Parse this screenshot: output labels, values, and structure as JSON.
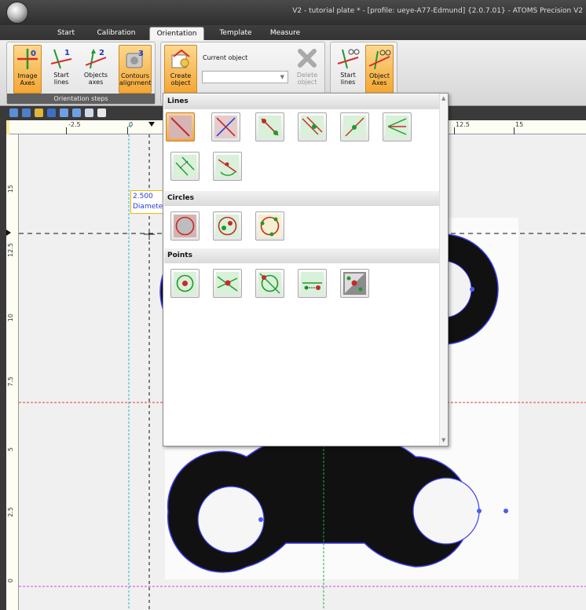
{
  "window": {
    "title": "V2 - tutorial plate * - [profile: ueye-A77-Edmund] {2.0.7.01} - ATOMS Precision V2"
  },
  "ribbon_tabs": [
    {
      "label": "Start"
    },
    {
      "label": "Calibration"
    },
    {
      "label": "Orientation",
      "active": true
    },
    {
      "label": "Template"
    },
    {
      "label": "Measure"
    }
  ],
  "orientation_steps": {
    "group_label": "Orientation steps",
    "buttons": [
      {
        "label": "Image Axes",
        "step": "0",
        "icon": "image-axes-icon"
      },
      {
        "label": "Start lines",
        "step": "1",
        "icon": "start-lines-icon"
      },
      {
        "label": "Objects axes",
        "step": "2",
        "icon": "objects-axes-icon"
      },
      {
        "label": "Contours alignment",
        "step": "3",
        "icon": "contours-alignment-icon"
      }
    ]
  },
  "object_group": {
    "create_label": "Create object",
    "current_label": "Current object",
    "current_value": "",
    "delete_label": "Delete object"
  },
  "axes_group": {
    "start_lines_label": "Start lines",
    "object_axes_label": "Object Axes"
  },
  "ruler": {
    "h_ticks": [
      "-2.5",
      "0",
      "12.5",
      "15"
    ],
    "v_ticks": [
      "15",
      "12.5",
      "10",
      "7.5",
      "5",
      "2.5",
      "0"
    ]
  },
  "coord_tip": {
    "value": "2.500",
    "label": "Diameter"
  },
  "dropdown": {
    "sections": [
      {
        "title": "Lines",
        "items": [
          "line-two-points-icon",
          "line-angle-icon",
          "line-red-points-icon",
          "line-parallel-icon",
          "line-perpendicular-icon",
          "line-bisector-icon",
          "line-distance-icon",
          "line-tangent-icon"
        ]
      },
      {
        "title": "Circles",
        "items": [
          "circle-fit-icon",
          "circle-two-points-icon",
          "circle-three-points-icon"
        ]
      },
      {
        "title": "Points",
        "items": [
          "point-center-icon",
          "point-intersection-icon",
          "point-circle-line-icon",
          "point-offset-icon",
          "point-contour-icon"
        ]
      }
    ]
  },
  "colors": {
    "accent": "#f5a632",
    "contour": "#3c3ef0",
    "cyan_line": "#2ab5c8",
    "red_line": "#e23c2c",
    "magenta_line": "#d24ad4",
    "green_line": "#27a64a"
  }
}
